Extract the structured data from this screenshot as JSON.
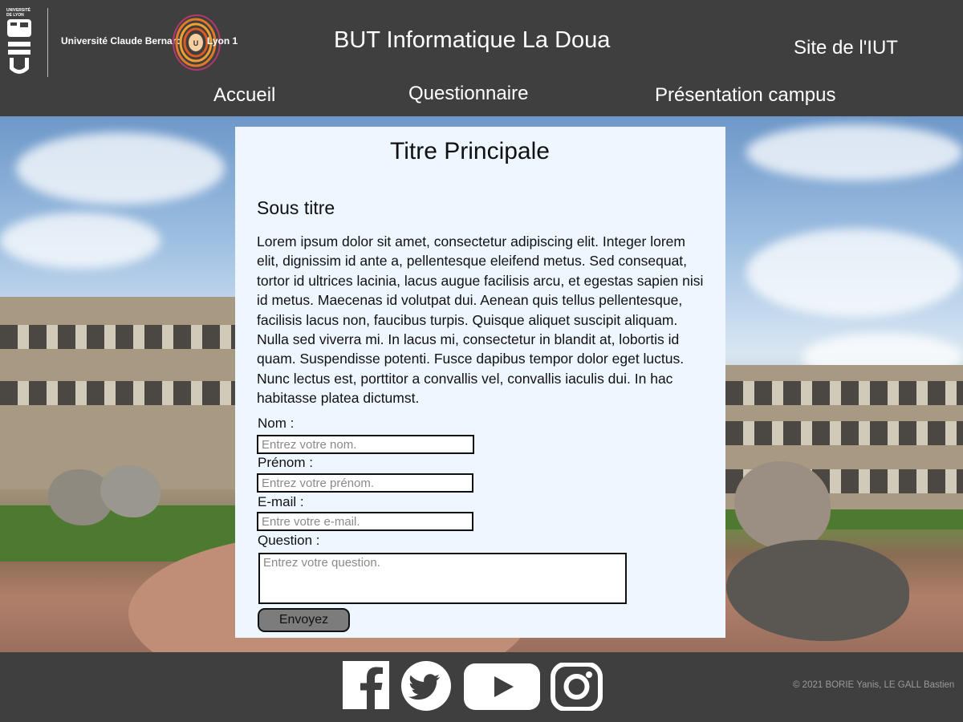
{
  "header": {
    "university_crest_text": "UNIVERSITÉ DE LYON",
    "university_name": "Université Claude Bernard",
    "university_city": "Lyon 1",
    "site_title": "BUT Informatique La Doua",
    "external_link": "Site de l'IUT",
    "nav": [
      {
        "label": "Accueil"
      },
      {
        "label": "Questionnaire"
      },
      {
        "label": "Présentation campus"
      }
    ]
  },
  "content": {
    "title": "Titre Principale",
    "subtitle": "Sous titre",
    "body": "Lorem ipsum dolor sit amet, consectetur adipiscing elit. Integer lorem elit, dignissim id ante a, pellentesque eleifend metus. Sed consequat, tortor id ultrices lacinia, lacus augue facilisis arcu, et egestas sapien nisi id metus. Maecenas id volutpat dui. Aenean quis tellus pellentesque, facilisis lacus non, faucibus turpis. Quisque aliquet suscipit aliquam. Nulla sed viverra mi. In lacus mi, consectetur in blandit at, lobortis id quam. Suspendisse potenti. Fusce dapibus tempor dolor eget luctus. Nunc lectus est, porttitor a convallis vel, convallis iaculis dui. In hac habitasse platea dictumst."
  },
  "form": {
    "nom_label": "Nom :",
    "nom_placeholder": "Entrez votre nom.",
    "prenom_label": "Prénom :",
    "prenom_placeholder": "Entrez votre prénom.",
    "email_label": "E-mail :",
    "email_placeholder": "Entre votre e-mail.",
    "question_label": "Question :",
    "question_placeholder": "Entrez votre question.",
    "submit_label": "Envoyez"
  },
  "footer": {
    "social": [
      "facebook-icon",
      "twitter-icon",
      "youtube-icon",
      "instagram-icon"
    ],
    "copyright": "© 2021 BORIE Yanis, LE GALL Bastien"
  },
  "colors": {
    "header_bg": "#3f3f3f",
    "card_bg": "#eef6ff",
    "button_bg": "#7c7c7c"
  }
}
